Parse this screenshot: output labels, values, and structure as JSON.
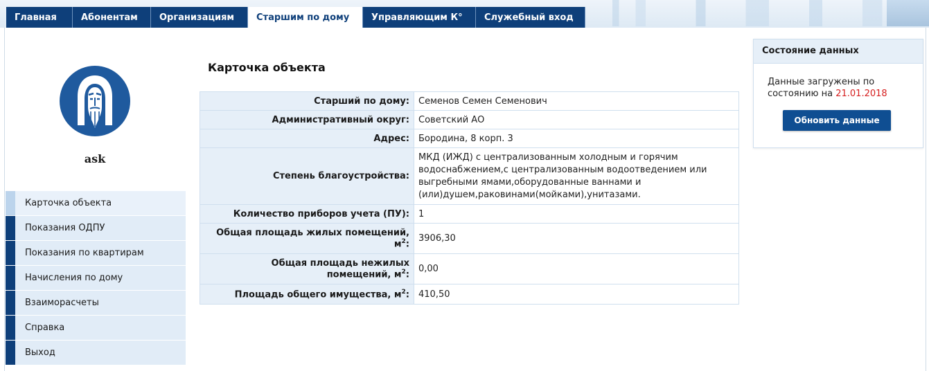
{
  "tabs": [
    {
      "label": "Главная"
    },
    {
      "label": "Абонентам"
    },
    {
      "label": "Организациям"
    },
    {
      "label": "Старшим по дому"
    },
    {
      "label": "Управляющим К°"
    },
    {
      "label": "Служебный вход"
    }
  ],
  "active_tab": "Старшим по дому",
  "user": {
    "name": "ask"
  },
  "sidebar": {
    "items": [
      {
        "label": "Карточка объекта"
      },
      {
        "label": "Показания ОДПУ"
      },
      {
        "label": "Показания по квартирам"
      },
      {
        "label": "Начисления по дому"
      },
      {
        "label": "Взаиморасчеты"
      },
      {
        "label": "Справка"
      },
      {
        "label": "Выход"
      }
    ]
  },
  "page": {
    "title": "Карточка объекта"
  },
  "card": {
    "rows": [
      {
        "label": "Старший по дому:",
        "value": "Семенов Семен Семенович"
      },
      {
        "label": "Административный округ:",
        "value": "Советский АО"
      },
      {
        "label": "Адрес:",
        "value": "Бородина, 8 корп. 3"
      },
      {
        "label": "Степень благоустройства:",
        "value": "МКД (ИЖД) с централизованным холодным и горячим водоснабжением,с централизованным водоотведением или выгребными ямами,оборудованные ваннами и (или)душем,раковинами(мойками),унитазами."
      },
      {
        "label": "Количество приборов учета (ПУ):",
        "value": "1"
      },
      {
        "label": "Общая площадь жилых помещений, м",
        "value": "3906,30"
      },
      {
        "label": "Общая площадь нежилых помещений, м",
        "value": "0,00"
      },
      {
        "label": "Площадь общего имущества, м",
        "value": "410,50"
      }
    ],
    "unit_sup": "2",
    "colon": ":"
  },
  "status_panel": {
    "title": "Состояние данных",
    "text": "Данные загружены по состоянию на",
    "date": "21.01.2018",
    "button_label": "Обновить данные"
  },
  "colors": {
    "nav": "#0e3f7a",
    "accent_date": "#d62020",
    "button": "#0f4e92"
  },
  "icons": {
    "logo": "bearded-face-logo-icon"
  }
}
